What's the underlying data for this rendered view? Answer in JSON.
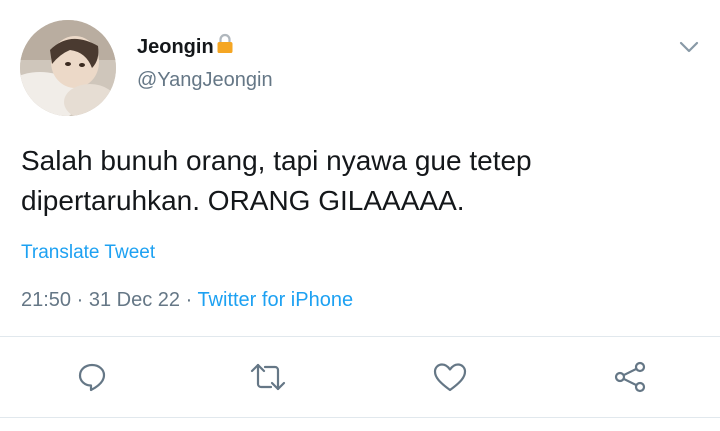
{
  "user": {
    "display_name": "Jeongin",
    "lock_icon": "lock-icon",
    "handle": "@YangJeongin"
  },
  "tweet": {
    "text": "Salah bunuh orang, tapi nyawa gue tetep\ndipertaruhkan. ORANG GILAAAAA.",
    "translate_label": "Translate Tweet",
    "time": "21:50",
    "separator": " · ",
    "date": "31 Dec 22",
    "source": "Twitter for iPhone"
  },
  "actions": [
    {
      "name": "reply",
      "icon": "reply-icon"
    },
    {
      "name": "retweet",
      "icon": "retweet-icon"
    },
    {
      "name": "like",
      "icon": "heart-icon"
    },
    {
      "name": "share",
      "icon": "share-icon"
    }
  ],
  "colors": {
    "link": "#1da1f2",
    "secondary_text": "#657786",
    "lock": "#f5a623",
    "divider": "#e1e8ed"
  }
}
